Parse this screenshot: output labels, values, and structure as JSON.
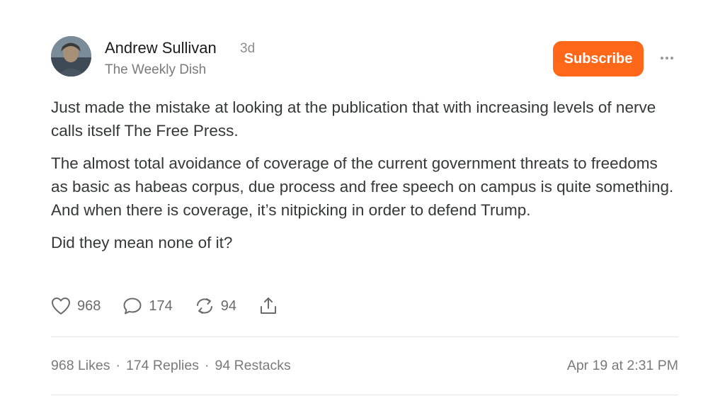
{
  "post": {
    "author": "Andrew Sullivan",
    "time_ago": "3d",
    "publication": "The Weekly Dish",
    "subscribe_label": "Subscribe",
    "paragraphs": [
      "Just made the mistake at looking at the publication that with increasing levels of nerve calls itself The Free Press.",
      "The almost total avoidance of coverage of the current government threats to freedoms as basic as habeas corpus, due process and free speech on campus is quite something. And when there is coverage, it’s nitpicking in order to defend Trump.",
      "Did they mean none of it?"
    ]
  },
  "actions": {
    "like_count": "968",
    "reply_count": "174",
    "restack_count": "94"
  },
  "stats": {
    "likes": "968 Likes",
    "replies": "174 Replies",
    "restacks": "94 Restacks",
    "separator": "·",
    "date": "Apr 19 at 2:31 PM"
  },
  "colors": {
    "accent": "#ff6719",
    "text": "#363737",
    "muted": "#7a7a7a"
  },
  "icons": {
    "like": "heart-icon",
    "reply": "speech-bubble-icon",
    "restack": "restack-icon",
    "share": "share-icon",
    "more": "ellipsis-icon"
  }
}
